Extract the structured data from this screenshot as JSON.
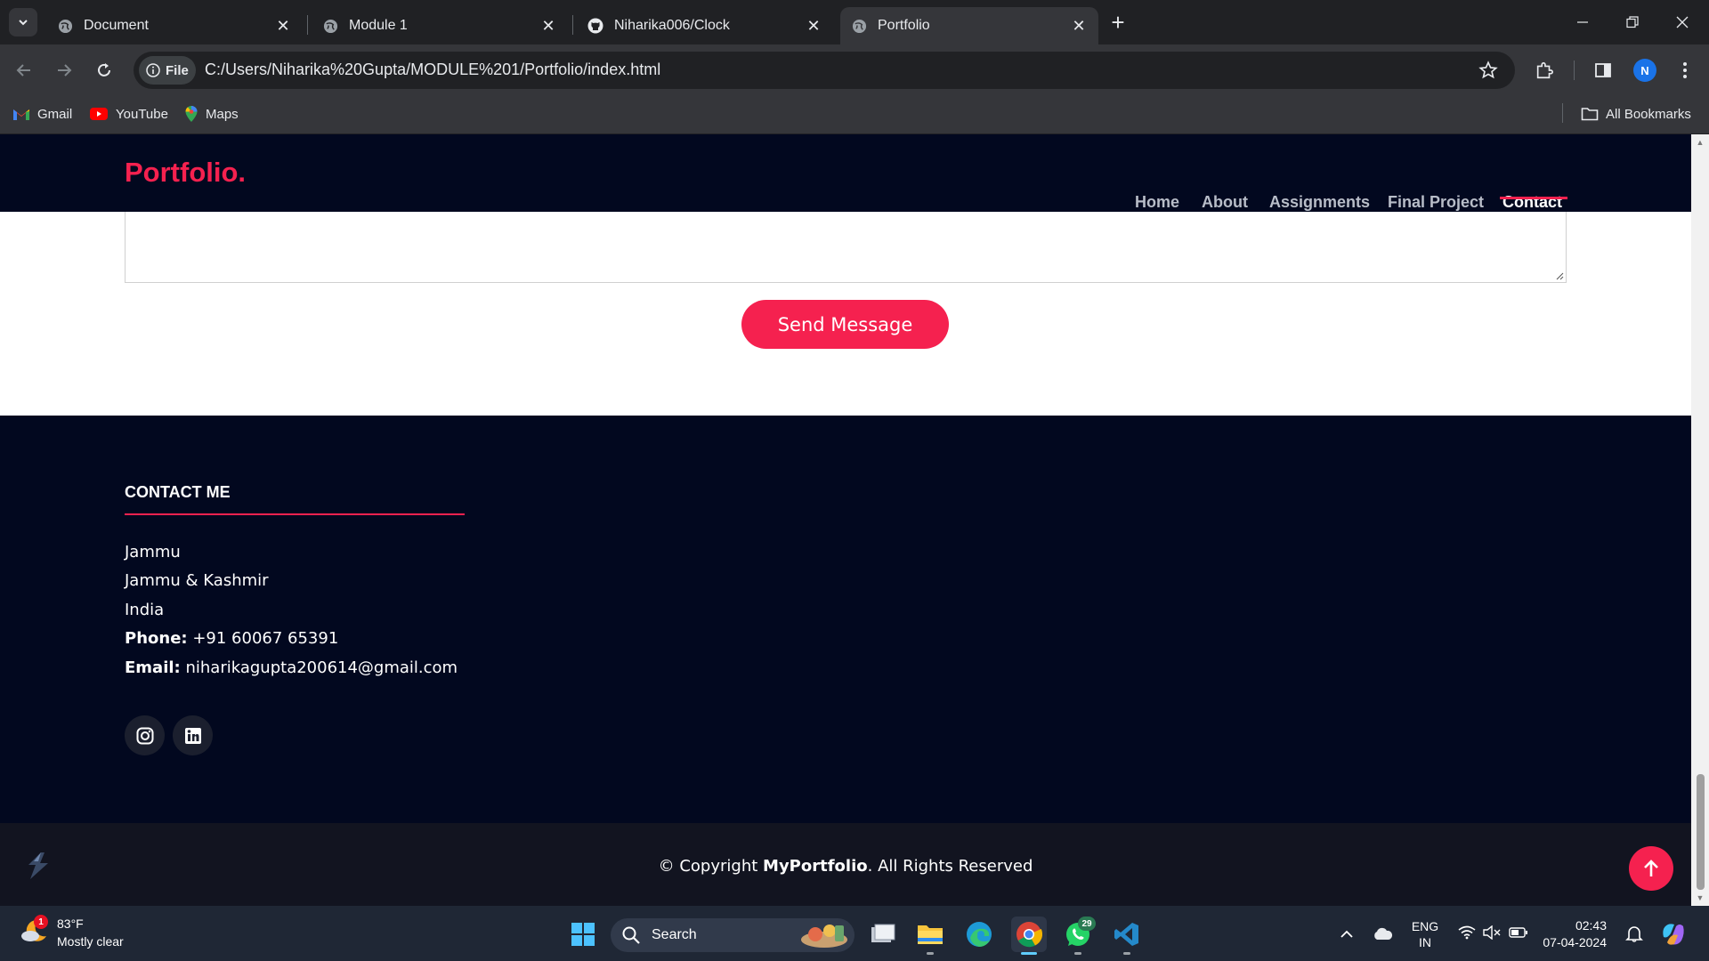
{
  "browser": {
    "tabs": [
      {
        "title": "Document",
        "icon": "globe-icon"
      },
      {
        "title": "Module 1",
        "icon": "globe-icon"
      },
      {
        "title": "Niharika006/Clock",
        "icon": "github-icon"
      },
      {
        "title": "Portfolio",
        "icon": "globe-icon"
      }
    ],
    "active_tab_index": 3,
    "scheme_chip": "File",
    "url": "C:/Users/Niharika%20Gupta/MODULE%201/Portfolio/index.html",
    "profile_initial": "N",
    "bookmarks": [
      {
        "label": "Gmail",
        "icon": "gmail-icon"
      },
      {
        "label": "YouTube",
        "icon": "youtube-icon"
      },
      {
        "label": "Maps",
        "icon": "maps-icon"
      }
    ],
    "all_bookmarks": "All Bookmarks"
  },
  "site": {
    "logo": "Portfolio.",
    "nav": [
      {
        "label": "Home"
      },
      {
        "label": "About"
      },
      {
        "label": "Assignments"
      },
      {
        "label": "Final Project"
      },
      {
        "label": "Contact"
      }
    ],
    "active_nav_index": 4,
    "send_button": "Send Message",
    "contact": {
      "title": "CONTACT ME",
      "city": "Jammu",
      "state": "Jammu & Kashmir",
      "country": "India",
      "phone_label": "Phone:",
      "phone": "+91 60067 65391",
      "email_label": "Email:",
      "email": "niharikagupta200614@gmail.com"
    },
    "social": [
      {
        "name": "instagram-icon"
      },
      {
        "name": "linkedin-icon"
      }
    ],
    "copyright_prefix": "© Copyright",
    "copyright_brand": "MyPortfolio",
    "copyright_suffix": ". All Rights Reserved"
  },
  "taskbar": {
    "weather_temp": "83°F",
    "weather_desc": "Mostly clear",
    "weather_badge": "1",
    "search_placeholder": "Search",
    "whatsapp_badge": "29",
    "lang_top": "ENG",
    "lang_bottom": "IN",
    "time": "02:43",
    "date": "07-04-2024"
  },
  "colors": {
    "accent": "#f5214f",
    "navy": "#02081f",
    "chrome_dark": "#202124",
    "chrome_mid": "#35363a",
    "taskbar": "#1f2735"
  }
}
